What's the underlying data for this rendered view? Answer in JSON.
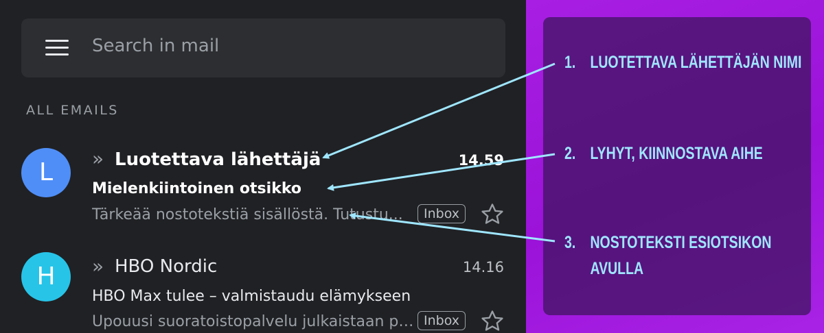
{
  "search": {
    "placeholder": "Search in mail"
  },
  "section": {
    "label": "ALL EMAILS"
  },
  "emails": [
    {
      "avatar_letter": "L",
      "avatar_color": "#4f8ef7",
      "chevrons": "»",
      "sender": "Luotettava lähettäjä",
      "time": "14.59",
      "subject": "Mielenkiintoinen otsikko",
      "snippet": "Tärkeää nostotekstiä sisällöstä. Tutustu...",
      "label": "Inbox",
      "unread": true
    },
    {
      "avatar_letter": "H",
      "avatar_color": "#27c4e8",
      "chevrons": "»",
      "sender": "HBO Nordic",
      "time": "14.16",
      "subject": "HBO Max tulee – valmistaudu elämykseen",
      "snippet": "Upouusi suoratoistopalvelu julkaistaan pian",
      "label": "Inbox",
      "unread": false
    }
  ],
  "annotations": [
    {
      "number": "1.",
      "lines": [
        "LUOTETTAVA LÄHETTÄJÄN NIMI"
      ]
    },
    {
      "number": "2.",
      "lines": [
        "LYHYT, KIINNOSTAVA AIHE"
      ]
    },
    {
      "number": "3.",
      "lines": [
        "NOSTOTEKSTI ESIOTSIKON",
        "AVULLA"
      ]
    }
  ],
  "colors": {
    "background": "#202124",
    "panel_purple": "#a81fe3",
    "annotation_text": "#9fe6ff",
    "arrow": "#9fe6ff"
  }
}
